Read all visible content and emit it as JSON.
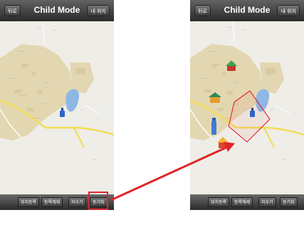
{
  "screens": [
    {
      "title": "Child Mode",
      "back_label": "뒤로",
      "my_location_label": "내 위치",
      "toolbar": [
        "위치등록",
        "등록해제",
        "지우기",
        "동기화"
      ]
    },
    {
      "title": "Child Mode",
      "back_label": "뒤로",
      "my_location_label": "내 위치",
      "toolbar": [
        "위치등록",
        "등록해제",
        "지우기",
        "동기화"
      ]
    }
  ],
  "colors": {
    "navbar": "#3a3a3a",
    "map_background": "#efede7",
    "campus_area": "#e3d7b1",
    "road": "#f4dc53",
    "lake": "#8db8e6",
    "highlight": "#e0252b",
    "arrow": "#e0252b"
  }
}
